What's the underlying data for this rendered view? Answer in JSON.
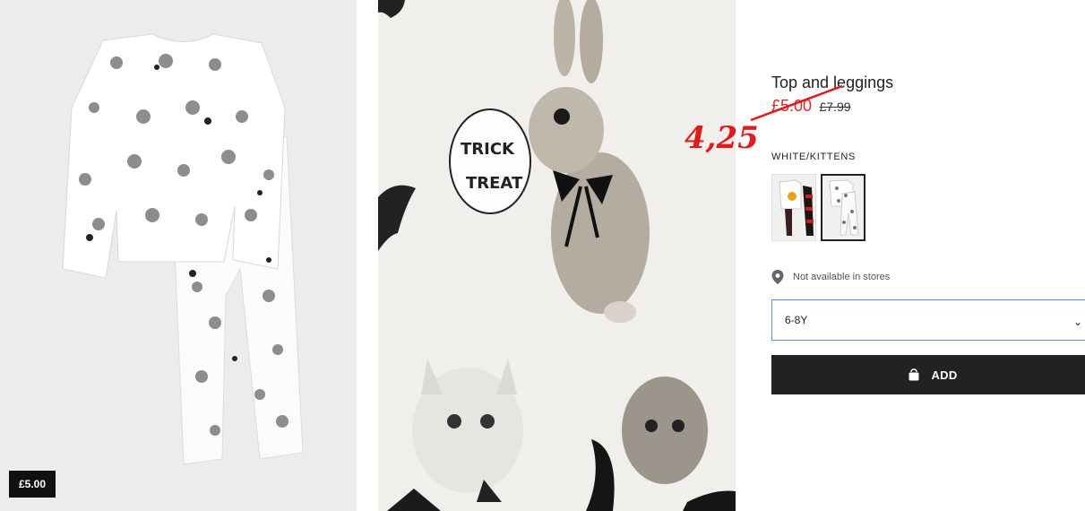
{
  "product": {
    "title": "Top and leggings",
    "sale_price": "£5.00",
    "old_price": "£7.99",
    "annotated_price": "4,25",
    "badge_price": "£5.00",
    "color_label": "WHITE/KITTENS",
    "availability": "Not available in stores",
    "size_selected": "6-8Y",
    "add_label": "ADD"
  },
  "colors": {
    "sale": "#d4302a",
    "annotation": "#e01b1b",
    "button": "#222222",
    "select_border": "#5b8def"
  },
  "icons": {
    "location": "map-pin-icon",
    "bag": "shopping-bag-icon",
    "chevron": "chevron-down-icon"
  },
  "image_text": {
    "speech_bubble_line1": "TRICK",
    "speech_bubble_line2": "TREAT"
  }
}
